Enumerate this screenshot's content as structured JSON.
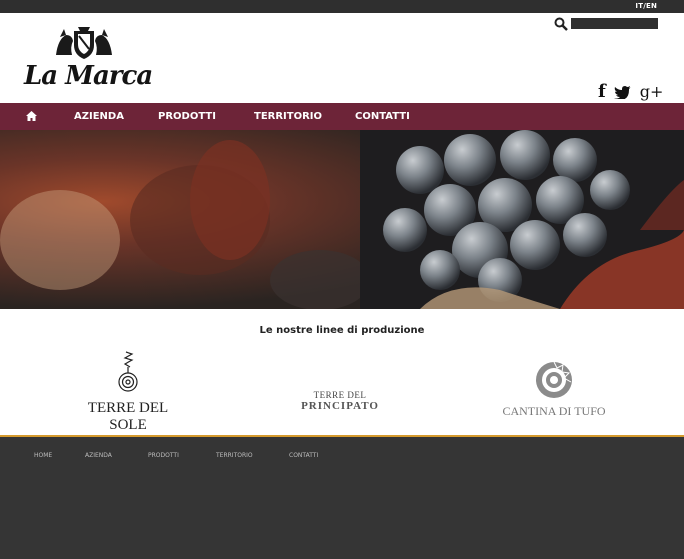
{
  "topbar": {
    "lang_label": "IT/EN"
  },
  "header": {
    "logo_text": "La Marca",
    "search": {
      "placeholder": ""
    },
    "social": {
      "facebook": "f",
      "googleplus": "g+"
    }
  },
  "nav": {
    "items": [
      {
        "label": ""
      },
      {
        "label": "AZIENDA"
      },
      {
        "label": "PRODOTTI"
      },
      {
        "label": "TERRITORIO"
      },
      {
        "label": "CONTATTI"
      }
    ]
  },
  "main": {
    "tagline": "Le nostre linee di produzione",
    "brands": [
      {
        "line1": "TERRE DEL SOLE"
      },
      {
        "line1": "TERRE DEL",
        "line2": "PRINCIPATO"
      },
      {
        "line1": "CANTINA DI TUFO"
      }
    ]
  },
  "footer": {
    "links": [
      {
        "label": "HOME"
      },
      {
        "label": "AZIENDA"
      },
      {
        "label": "PRODOTTI"
      },
      {
        "label": "TERRITORIO"
      },
      {
        "label": "CONTATTI"
      }
    ]
  },
  "colors": {
    "nav_bg": "#6d2438",
    "accent": "#d59a2d",
    "footer_bg": "#353535",
    "topbar_bg": "#2f2f2f"
  }
}
